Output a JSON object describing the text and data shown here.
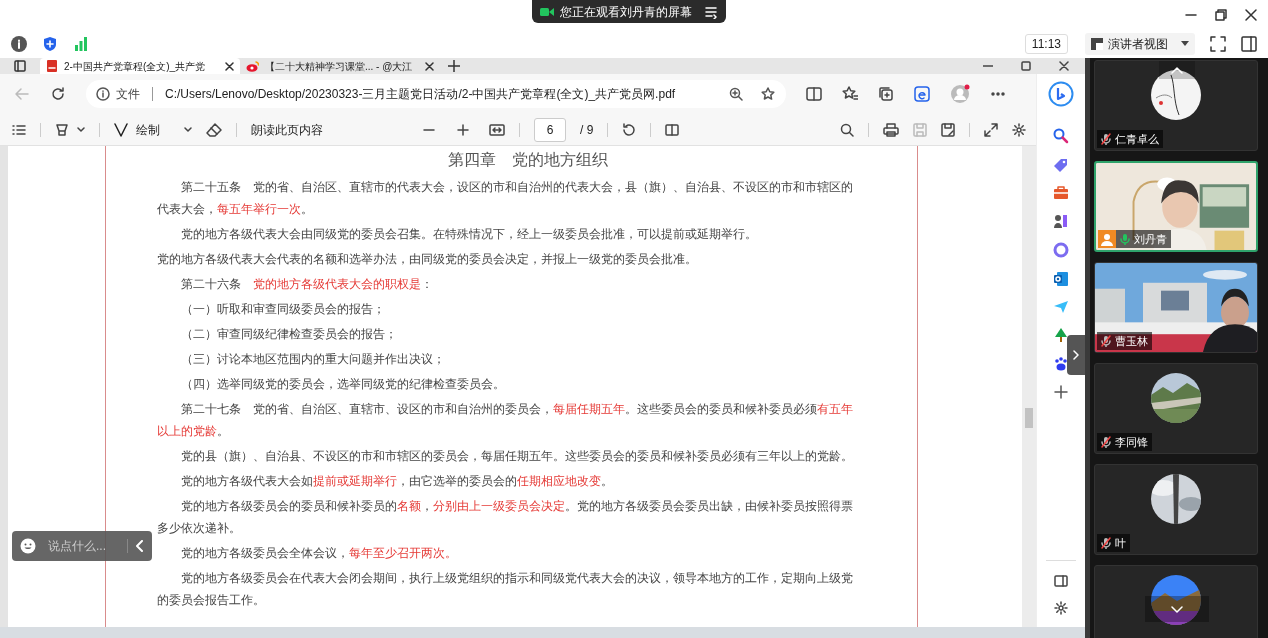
{
  "meeting_bar": {
    "banner": "您正在观看刘丹青的屏幕",
    "time": "11:13",
    "view_menu": "演讲者视图"
  },
  "browser": {
    "tabs": [
      {
        "title": "2-中国共产党章程(全文)_共产党",
        "selected": true
      },
      {
        "title": "【二十大精神学习课堂... - @大江",
        "selected": false
      }
    ],
    "address": {
      "scheme": "文件",
      "url": "C:/Users/Lenovo/Desktop/20230323-三月主题党日活动/2-中国共产党章程(全文)_共产党员网.pdf"
    }
  },
  "pdf_toolbar": {
    "draw_label": "绘制",
    "read_aloud": "朗读此页内容",
    "page": "6",
    "page_total": "/ 9"
  },
  "document": {
    "title": "第四章　党的地方组织",
    "paragraphs": [
      {
        "indent": true,
        "segments": [
          {
            "text": "第二十五条　党的省、自治区、直辖市的代表大会，设区的市和自治州的代表大会，县（旗）、自治县、不设区的市和市辖区的代表大会，",
            "emphasis": false
          },
          {
            "text": "每五年举行一次",
            "emphasis": true
          },
          {
            "text": "。",
            "emphasis": false
          }
        ]
      },
      {
        "indent": true,
        "segments": [
          {
            "text": "党的地方各级代表大会由同级党的委员会召集。在特殊情况下，经上一级委员会批准，可以提前或延期举行。",
            "emphasis": false
          }
        ]
      },
      {
        "indent": false,
        "segments": [
          {
            "text": "党的地方各级代表大会代表的名额和选举办法，由同级党的委员会决定，并报上一级党的委员会批准。",
            "emphasis": false
          }
        ]
      },
      {
        "indent": true,
        "segments": [
          {
            "text": "第二十六条　",
            "emphasis": false
          },
          {
            "text": "党的地方各级代表大会的职权是",
            "emphasis": true
          },
          {
            "text": "：",
            "emphasis": false
          }
        ]
      },
      {
        "indent": true,
        "segments": [
          {
            "text": "（一）听取和审查同级委员会的报告；",
            "emphasis": false
          }
        ]
      },
      {
        "indent": true,
        "segments": [
          {
            "text": "（二）审查同级纪律检查委员会的报告；",
            "emphasis": false
          }
        ]
      },
      {
        "indent": true,
        "segments": [
          {
            "text": "（三）讨论本地区范围内的重大问题并作出决议；",
            "emphasis": false
          }
        ]
      },
      {
        "indent": true,
        "segments": [
          {
            "text": "（四）选举同级党的委员会，选举同级党的纪律检查委员会。",
            "emphasis": false
          }
        ]
      },
      {
        "indent": true,
        "segments": [
          {
            "text": "第二十七条　党的省、自治区、直辖市、设区的市和自治州的委员会，",
            "emphasis": false
          },
          {
            "text": "每届任期五年",
            "emphasis": true
          },
          {
            "text": "。这些委员会的委员和候补委员必须",
            "emphasis": false
          },
          {
            "text": "有五年以上的党龄",
            "emphasis": true
          },
          {
            "text": "。",
            "emphasis": false
          }
        ]
      },
      {
        "indent": true,
        "segments": [
          {
            "text": "党的县（旗）、自治县、不设区的市和市辖区的委员会，每届任期五年。这些委员会的委员和候补委员必须有三年以上的党龄。",
            "emphasis": false
          }
        ]
      },
      {
        "indent": true,
        "segments": [
          {
            "text": "党的地方各级代表大会如",
            "emphasis": false
          },
          {
            "text": "提前或延期举行",
            "emphasis": true
          },
          {
            "text": "，由它选举的委员会的",
            "emphasis": false
          },
          {
            "text": "任期相应地改变",
            "emphasis": true
          },
          {
            "text": "。",
            "emphasis": false
          }
        ]
      },
      {
        "indent": true,
        "segments": [
          {
            "text": "党的地方各级委员会的委员和候补委员的",
            "emphasis": false
          },
          {
            "text": "名额",
            "emphasis": true
          },
          {
            "text": "，",
            "emphasis": false
          },
          {
            "text": "分别由上一级委员会决定",
            "emphasis": true
          },
          {
            "text": "。党的地方各级委员会委员出缺，由候补委员按照得票多少依次递补。",
            "emphasis": false
          }
        ]
      },
      {
        "indent": true,
        "segments": [
          {
            "text": "党的地方各级委员会全体会议，",
            "emphasis": false
          },
          {
            "text": "每年至少召开两次。",
            "emphasis": true
          }
        ]
      },
      {
        "indent": true,
        "segments": [
          {
            "text": "党的地方各级委员会在代表大会闭会期间，执行上级党组织的指示和同级党代表大会的决议，领导本地方的工作，定期向上级党的委员会报告工作。",
            "emphasis": false
          }
        ]
      }
    ]
  },
  "comment_box": {
    "placeholder": "说点什么..."
  },
  "participants": [
    {
      "name": "仁青卓么",
      "kind": "avatar",
      "muted": true,
      "active": false,
      "host": false
    },
    {
      "name": "刘丹青",
      "kind": "video",
      "muted": false,
      "active": true,
      "host": true
    },
    {
      "name": "曹玉林",
      "kind": "video",
      "muted": true,
      "active": false,
      "host": false
    },
    {
      "name": "李同锋",
      "kind": "avatar",
      "muted": true,
      "active": false,
      "host": false
    },
    {
      "name": "叶",
      "kind": "avatar",
      "muted": true,
      "active": false,
      "host": false
    },
    {
      "kind": "avatar",
      "active": false,
      "host": false
    }
  ]
}
